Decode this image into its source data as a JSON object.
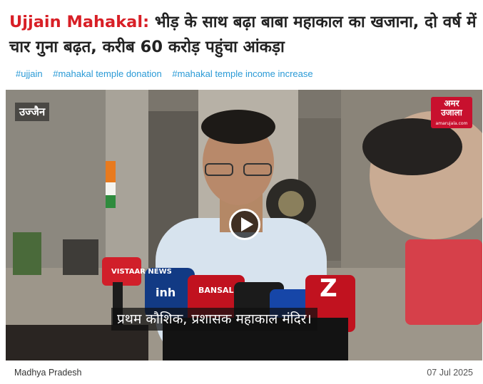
{
  "article": {
    "kicker": "Ujjain Mahakal:",
    "title": "भीड़ के साथ बढ़ा बाबा महाकाल का खजाना, दो वर्ष में चार गुना बढ़त, करीब 60 करोड़ पहुंचा आंकड़ा"
  },
  "tags": [
    "#ujjain",
    "#mahakal temple donation",
    "#mahakal temple income increase"
  ],
  "video": {
    "city_label": "उज्जैन",
    "logo_text_line1": "अमर",
    "logo_text_line2": "उजाला",
    "logo_site": "amarujala.com",
    "caption": "प्रथम कौशिक, प्रशासक महाकाल मंदिर।",
    "mic_labels": [
      "VISTAAR NEWS",
      "inh",
      "BANSAL",
      "Z"
    ]
  },
  "footer": {
    "state": "Madhya Pradesh",
    "date": "07 Jul 2025"
  },
  "colors": {
    "accent": "#d81f26",
    "tag": "#2a9ad6",
    "logo": "#c8102e"
  }
}
